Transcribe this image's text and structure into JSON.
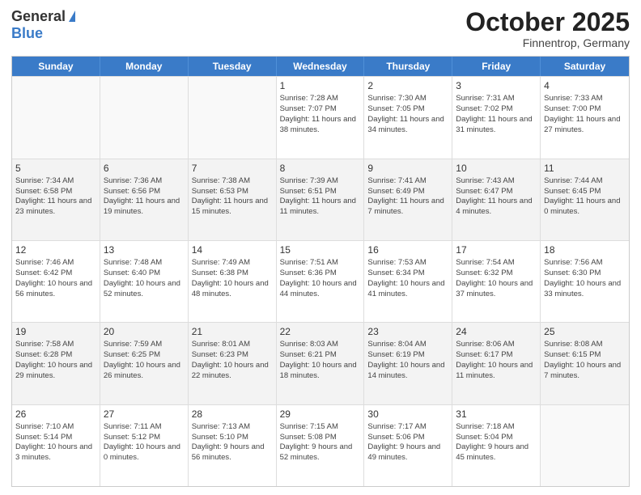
{
  "header": {
    "logo_general": "General",
    "logo_blue": "Blue",
    "month_title": "October 2025",
    "subtitle": "Finnentrop, Germany"
  },
  "weekdays": [
    "Sunday",
    "Monday",
    "Tuesday",
    "Wednesday",
    "Thursday",
    "Friday",
    "Saturday"
  ],
  "rows": [
    [
      {
        "day": "",
        "info": ""
      },
      {
        "day": "",
        "info": ""
      },
      {
        "day": "",
        "info": ""
      },
      {
        "day": "1",
        "info": "Sunrise: 7:28 AM\nSunset: 7:07 PM\nDaylight: 11 hours and 38 minutes."
      },
      {
        "day": "2",
        "info": "Sunrise: 7:30 AM\nSunset: 7:05 PM\nDaylight: 11 hours and 34 minutes."
      },
      {
        "day": "3",
        "info": "Sunrise: 7:31 AM\nSunset: 7:02 PM\nDaylight: 11 hours and 31 minutes."
      },
      {
        "day": "4",
        "info": "Sunrise: 7:33 AM\nSunset: 7:00 PM\nDaylight: 11 hours and 27 minutes."
      }
    ],
    [
      {
        "day": "5",
        "info": "Sunrise: 7:34 AM\nSunset: 6:58 PM\nDaylight: 11 hours and 23 minutes."
      },
      {
        "day": "6",
        "info": "Sunrise: 7:36 AM\nSunset: 6:56 PM\nDaylight: 11 hours and 19 minutes."
      },
      {
        "day": "7",
        "info": "Sunrise: 7:38 AM\nSunset: 6:53 PM\nDaylight: 11 hours and 15 minutes."
      },
      {
        "day": "8",
        "info": "Sunrise: 7:39 AM\nSunset: 6:51 PM\nDaylight: 11 hours and 11 minutes."
      },
      {
        "day": "9",
        "info": "Sunrise: 7:41 AM\nSunset: 6:49 PM\nDaylight: 11 hours and 7 minutes."
      },
      {
        "day": "10",
        "info": "Sunrise: 7:43 AM\nSunset: 6:47 PM\nDaylight: 11 hours and 4 minutes."
      },
      {
        "day": "11",
        "info": "Sunrise: 7:44 AM\nSunset: 6:45 PM\nDaylight: 11 hours and 0 minutes."
      }
    ],
    [
      {
        "day": "12",
        "info": "Sunrise: 7:46 AM\nSunset: 6:42 PM\nDaylight: 10 hours and 56 minutes."
      },
      {
        "day": "13",
        "info": "Sunrise: 7:48 AM\nSunset: 6:40 PM\nDaylight: 10 hours and 52 minutes."
      },
      {
        "day": "14",
        "info": "Sunrise: 7:49 AM\nSunset: 6:38 PM\nDaylight: 10 hours and 48 minutes."
      },
      {
        "day": "15",
        "info": "Sunrise: 7:51 AM\nSunset: 6:36 PM\nDaylight: 10 hours and 44 minutes."
      },
      {
        "day": "16",
        "info": "Sunrise: 7:53 AM\nSunset: 6:34 PM\nDaylight: 10 hours and 41 minutes."
      },
      {
        "day": "17",
        "info": "Sunrise: 7:54 AM\nSunset: 6:32 PM\nDaylight: 10 hours and 37 minutes."
      },
      {
        "day": "18",
        "info": "Sunrise: 7:56 AM\nSunset: 6:30 PM\nDaylight: 10 hours and 33 minutes."
      }
    ],
    [
      {
        "day": "19",
        "info": "Sunrise: 7:58 AM\nSunset: 6:28 PM\nDaylight: 10 hours and 29 minutes."
      },
      {
        "day": "20",
        "info": "Sunrise: 7:59 AM\nSunset: 6:25 PM\nDaylight: 10 hours and 26 minutes."
      },
      {
        "day": "21",
        "info": "Sunrise: 8:01 AM\nSunset: 6:23 PM\nDaylight: 10 hours and 22 minutes."
      },
      {
        "day": "22",
        "info": "Sunrise: 8:03 AM\nSunset: 6:21 PM\nDaylight: 10 hours and 18 minutes."
      },
      {
        "day": "23",
        "info": "Sunrise: 8:04 AM\nSunset: 6:19 PM\nDaylight: 10 hours and 14 minutes."
      },
      {
        "day": "24",
        "info": "Sunrise: 8:06 AM\nSunset: 6:17 PM\nDaylight: 10 hours and 11 minutes."
      },
      {
        "day": "25",
        "info": "Sunrise: 8:08 AM\nSunset: 6:15 PM\nDaylight: 10 hours and 7 minutes."
      }
    ],
    [
      {
        "day": "26",
        "info": "Sunrise: 7:10 AM\nSunset: 5:14 PM\nDaylight: 10 hours and 3 minutes."
      },
      {
        "day": "27",
        "info": "Sunrise: 7:11 AM\nSunset: 5:12 PM\nDaylight: 10 hours and 0 minutes."
      },
      {
        "day": "28",
        "info": "Sunrise: 7:13 AM\nSunset: 5:10 PM\nDaylight: 9 hours and 56 minutes."
      },
      {
        "day": "29",
        "info": "Sunrise: 7:15 AM\nSunset: 5:08 PM\nDaylight: 9 hours and 52 minutes."
      },
      {
        "day": "30",
        "info": "Sunrise: 7:17 AM\nSunset: 5:06 PM\nDaylight: 9 hours and 49 minutes."
      },
      {
        "day": "31",
        "info": "Sunrise: 7:18 AM\nSunset: 5:04 PM\nDaylight: 9 hours and 45 minutes."
      },
      {
        "day": "",
        "info": ""
      }
    ]
  ]
}
